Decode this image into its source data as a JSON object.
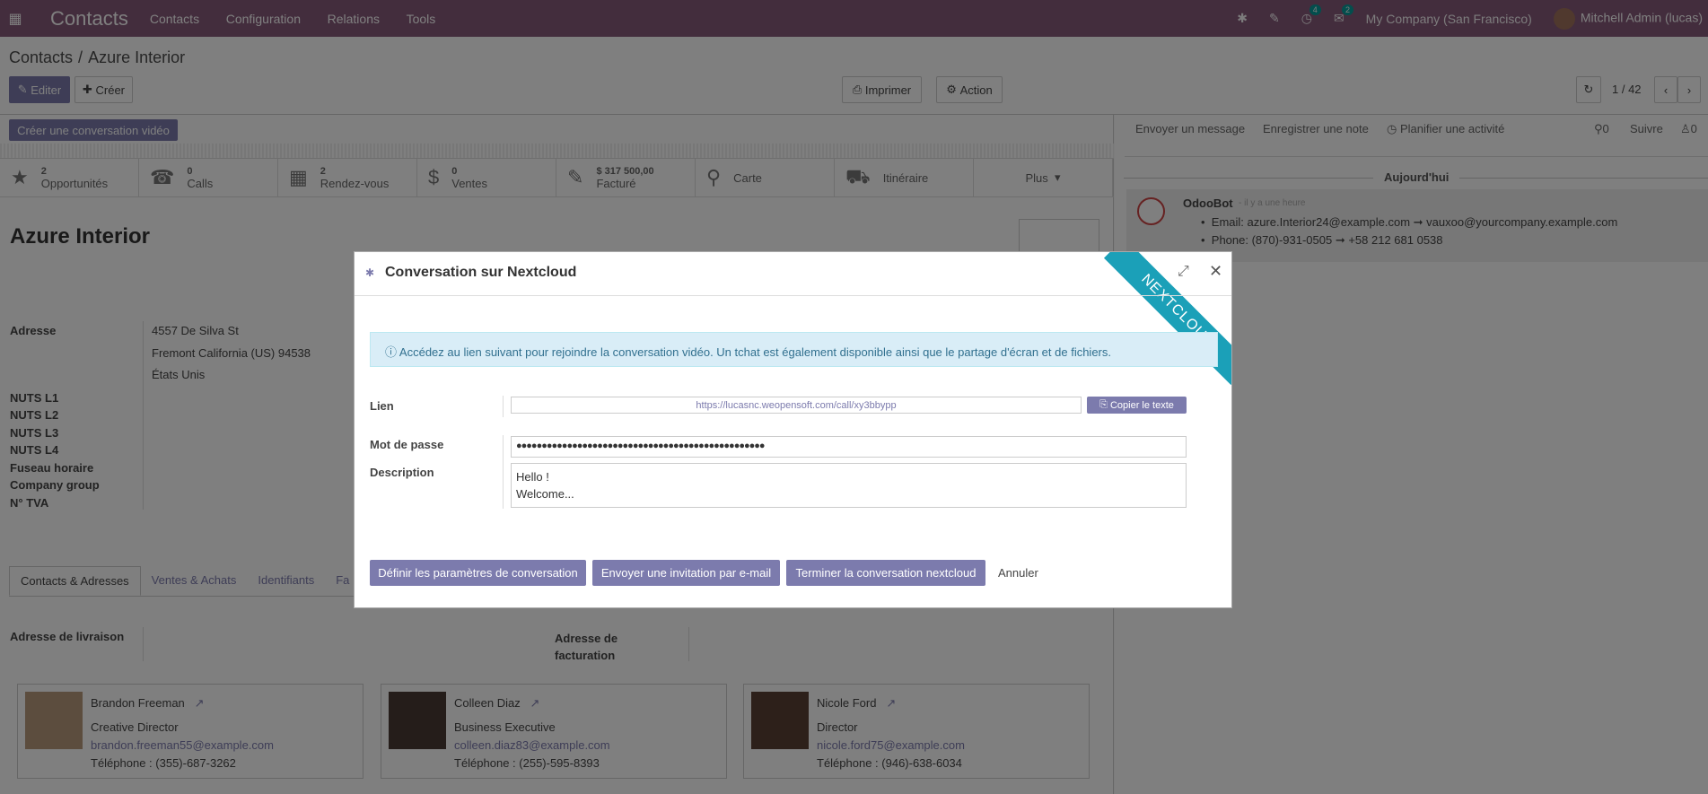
{
  "navbar": {
    "brand": "Contacts",
    "menu": [
      "Contacts",
      "Configuration",
      "Relations",
      "Tools"
    ],
    "activity_count": "4",
    "messages_count": "2",
    "company": "My Company (San Francisco)",
    "user": "Mitchell Admin (lucas)"
  },
  "breadcrumb": {
    "root": "Contacts",
    "current": "Azure Interior"
  },
  "toolbar": {
    "edit": "Editer",
    "create": "Créer",
    "print": "Imprimer",
    "action": "Action",
    "pager": "1 / 42",
    "video": "Créer une conversation vidéo"
  },
  "stats": [
    {
      "icon": "star-icon",
      "value": "2",
      "label": "Opportunités"
    },
    {
      "icon": "phone-icon",
      "value": "0",
      "label": "Calls"
    },
    {
      "icon": "calendar-icon",
      "value": "2",
      "label": "Rendez-vous"
    },
    {
      "icon": "dollar-icon",
      "value": "0",
      "label": "Ventes"
    },
    {
      "icon": "edit-icon",
      "value": "$ 317 500,00",
      "label": "Facturé"
    },
    {
      "icon": "map-marker-icon",
      "value": "",
      "label": "Carte"
    },
    {
      "icon": "car-icon",
      "value": "",
      "label": "Itinéraire"
    },
    {
      "icon": "",
      "value": "",
      "label": "Plus"
    }
  ],
  "partner": {
    "name": "Azure Interior",
    "address_label": "Adresse",
    "street": "4557 De Silva St",
    "city_line": "Fremont  California (US)  94538",
    "country": "États Unis",
    "fields": [
      "NUTS L1",
      "NUTS L2",
      "NUTS L3",
      "NUTS L4",
      "Fuseau horaire",
      "Company group",
      "N° TVA"
    ]
  },
  "tabs": [
    "Contacts & Adresses",
    "Ventes & Achats",
    "Identifiants",
    "Fa"
  ],
  "addresses": {
    "delivery": "Adresse de livraison",
    "invoice": "Adresse de facturation"
  },
  "contacts": [
    {
      "name": "Brandon Freeman",
      "job": "Creative Director",
      "email": "brandon.freeman55@example.com",
      "phone": "Téléphone : (355)-687-3262"
    },
    {
      "name": "Colleen Diaz",
      "job": "Business Executive",
      "email": "colleen.diaz83@example.com",
      "phone": "Téléphone : (255)-595-8393"
    },
    {
      "name": "Nicole Ford",
      "job": "Director",
      "email": "nicole.ford75@example.com",
      "phone": "Téléphone : (946)-638-6034"
    }
  ],
  "chatter": {
    "send_message": "Envoyer un message",
    "log_note": "Enregistrer une note",
    "schedule": "Planifier une activité",
    "attachments": "0",
    "follow": "Suivre",
    "followers": "0",
    "today": "Aujourd'hui",
    "author": "OdooBot",
    "time": "- il y a une heure",
    "line1": "Email: azure.Interior24@example.com ➞ vauxoo@yourcompany.example.com",
    "line2": "Phone: (870)-931-0505 ➞ +58 212 681 0538"
  },
  "modal": {
    "title": "Conversation sur Nextcloud",
    "ribbon": "NEXTCLOUD",
    "alert": "Accédez au lien suivant pour rejoindre la conversation vidéo. Un tchat est également disponible ainsi que le partage d'écran et de fichiers.",
    "link_label": "Lien",
    "link_value": "https://lucasnc.weopensoft.com/call/xy3bbypp",
    "copy": "Copier le texte",
    "password_label": "Mot de passe",
    "password_value": "●●●●●●●●●●●●●●●●●●●●●●●●●●●●●●●●●●●●●●●●●●●●●●●●●",
    "description_label": "Description",
    "description_line1": "Hello !",
    "description_line2": "Welcome...",
    "btn_params": "Définir les paramètres de conversation",
    "btn_invite": "Envoyer une invitation par e-mail",
    "btn_end": "Terminer la conversation nextcloud",
    "btn_cancel": "Annuler"
  }
}
